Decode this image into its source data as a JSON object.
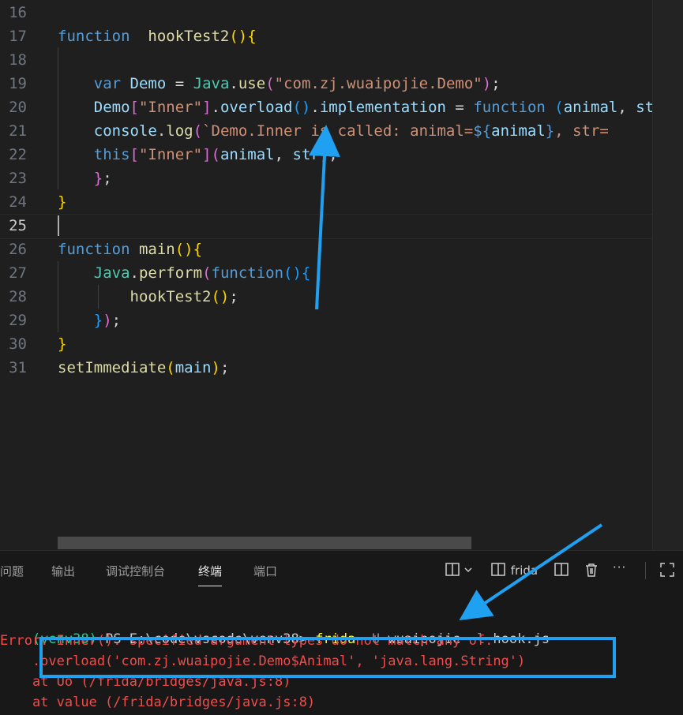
{
  "editor": {
    "lines": [
      {
        "num": "16",
        "parts": []
      },
      {
        "num": "17",
        "parts": [
          [
            "kw",
            "function"
          ],
          [
            "",
            "  "
          ],
          [
            "fn",
            "hookTest2"
          ],
          [
            "b1",
            "()"
          ],
          [
            "b1",
            "{"
          ]
        ]
      },
      {
        "num": "18",
        "parts": []
      },
      {
        "num": "19",
        "parts": [
          [
            "",
            "    "
          ],
          [
            "kw",
            "var"
          ],
          [
            "",
            " "
          ],
          [
            "var",
            "Demo"
          ],
          [
            "",
            " = "
          ],
          [
            "cls",
            "Java"
          ],
          [
            "",
            "."
          ],
          [
            "fn",
            "use"
          ],
          [
            "b2",
            "("
          ],
          [
            "str",
            "\"com.zj.wuaipojie.Demo\""
          ],
          [
            "b2",
            ")"
          ],
          [
            "",
            ";"
          ]
        ]
      },
      {
        "num": "20",
        "parts": [
          [
            "",
            "    "
          ],
          [
            "var",
            "Demo"
          ],
          [
            "b2",
            "["
          ],
          [
            "str",
            "\"Inner\""
          ],
          [
            "b2",
            "]"
          ],
          [
            "",
            "."
          ],
          [
            "var",
            "overload"
          ],
          [
            "b3",
            "()"
          ],
          [
            "",
            "."
          ],
          [
            "var",
            "implementation"
          ],
          [
            "",
            " = "
          ],
          [
            "kw",
            "function"
          ],
          [
            "",
            " "
          ],
          [
            "b3",
            "("
          ],
          [
            "var",
            "animal"
          ],
          [
            ", "
          ],
          [
            "var",
            "str"
          ]
        ]
      },
      {
        "num": "21",
        "parts": [
          [
            "",
            "    "
          ],
          [
            "var",
            "console"
          ],
          [
            "",
            "."
          ],
          [
            "fn",
            "log"
          ],
          [
            "b2",
            "("
          ],
          [
            "str",
            "`Demo.Inner is called: animal="
          ],
          [
            "kw",
            "${"
          ],
          [
            "var",
            "animal"
          ],
          [
            "kw",
            "}"
          ],
          [
            "str",
            ", str="
          ]
        ]
      },
      {
        "num": "22",
        "parts": [
          [
            "",
            "    "
          ],
          [
            "kw",
            "this"
          ],
          [
            "b2",
            "["
          ],
          [
            "str",
            "\"Inner\""
          ],
          [
            "b2",
            "]"
          ],
          [
            "b2",
            "("
          ],
          [
            "var",
            "animal"
          ],
          [
            "",
            ", "
          ],
          [
            "var",
            "str"
          ],
          [
            "b2",
            ")"
          ],
          [
            "",
            ";"
          ]
        ]
      },
      {
        "num": "23",
        "parts": [
          [
            "",
            "    "
          ],
          [
            "b2",
            "}"
          ],
          [
            "",
            ";"
          ]
        ]
      },
      {
        "num": "24",
        "parts": [
          [
            "b1",
            "}"
          ]
        ]
      },
      {
        "num": "25",
        "parts": []
      },
      {
        "num": "26",
        "parts": [
          [
            "kw",
            "function"
          ],
          [
            "",
            " "
          ],
          [
            "fn",
            "main"
          ],
          [
            "b1",
            "()"
          ],
          [
            "b1",
            "{"
          ]
        ]
      },
      {
        "num": "27",
        "parts": [
          [
            "",
            "    "
          ],
          [
            "cls",
            "Java"
          ],
          [
            "",
            "."
          ],
          [
            "fn",
            "perform"
          ],
          [
            "b2",
            "("
          ],
          [
            "kw",
            "function"
          ],
          [
            "b3",
            "()"
          ],
          [
            "b3",
            "{"
          ]
        ]
      },
      {
        "num": "28",
        "parts": [
          [
            "",
            "        "
          ],
          [
            "fn",
            "hookTest2"
          ],
          [
            "b1",
            "()"
          ],
          [
            "",
            ";"
          ]
        ]
      },
      {
        "num": "29",
        "parts": [
          [
            "",
            "    "
          ],
          [
            "b3",
            "}"
          ],
          [
            "b2",
            ")"
          ],
          [
            "",
            ";"
          ]
        ]
      },
      {
        "num": "30",
        "parts": [
          [
            "b1",
            "}"
          ]
        ]
      },
      {
        "num": "31",
        "parts": [
          [
            "fn",
            "setImmediate"
          ],
          [
            "b1",
            "("
          ],
          [
            "var",
            "main"
          ],
          [
            "b1",
            ")"
          ],
          [
            "",
            ";"
          ]
        ]
      }
    ],
    "active_line": "25"
  },
  "panel": {
    "tabs": [
      "问题",
      "输出",
      "调试控制台",
      "终端",
      "端口"
    ],
    "active_tab": "终端",
    "terminal_name": "frida",
    "more": "···"
  },
  "terminal": {
    "prompt_env": "(venv38)",
    "prompt_path": " PS E:\\code\\vscode\\venv38> ",
    "cmd": "frida",
    "cmd_args": " -U ",
    "cmd_target": "wuaipojie",
    "cmd_flag": " -l ",
    "cmd_file": "hook.js",
    "error_line": "Error: Inner(): specified argument types do not match any of:",
    "overload_line": "    .overload('com.zj.wuaipojie.Demo$Animal', 'java.lang.String')",
    "at1": "    at Uo (/frida/bridges/java.js:8)",
    "at2": "    at value (/frida/bridges/java.js:8)"
  }
}
